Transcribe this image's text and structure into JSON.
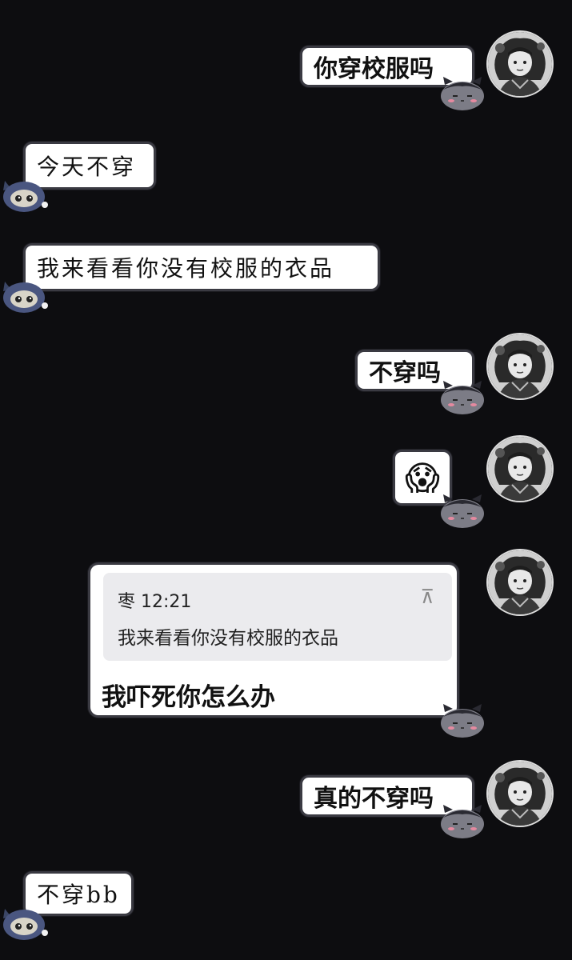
{
  "messages": [
    {
      "id": 1,
      "side": "sent",
      "text": "你穿校服吗"
    },
    {
      "id": 2,
      "side": "received",
      "text": "今天不穿"
    },
    {
      "id": 3,
      "side": "received",
      "text": "我来看看你没有校服的衣品"
    },
    {
      "id": 4,
      "side": "sent",
      "text": "不穿吗"
    },
    {
      "id": 5,
      "side": "sent",
      "text": "😱"
    },
    {
      "id": 6,
      "side": "sent",
      "quote": {
        "sender": "枣",
        "time": "12:21",
        "text": "我来看看你没有校服的衣品",
        "icon": "pin-top-icon"
      },
      "text": "我吓死你怎么办"
    },
    {
      "id": 7,
      "side": "sent",
      "text": "真的不穿吗"
    },
    {
      "id": 8,
      "side": "received",
      "text": "不穿bb"
    }
  ],
  "icons": {
    "sent_avatar": "anime-character-avatar",
    "sent_sticker": "gray-cat-blob-sticker",
    "received_sticker": "blue-ninja-blob-sticker"
  },
  "colors": {
    "background": "#0d0d10",
    "bubble": "#ffffff",
    "quote_box": "#ebebee"
  }
}
